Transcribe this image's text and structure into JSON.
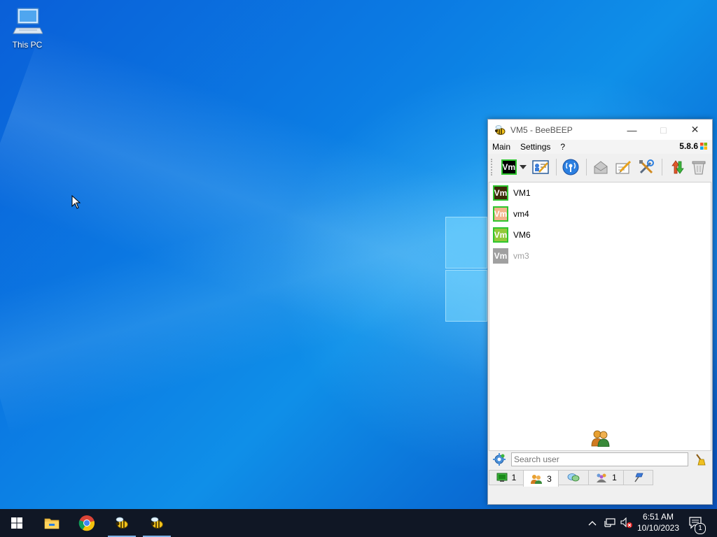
{
  "desktop": {
    "icons": [
      {
        "label": "This PC",
        "icon": "computer-icon"
      }
    ]
  },
  "window": {
    "title": "VM5 - BeeBEEP",
    "controls": {
      "minimize": "—",
      "maximize": "□",
      "close": "✕"
    },
    "menu": [
      "Main",
      "Settings",
      "?"
    ],
    "version": "5.8.6",
    "toolbar": {
      "status_badge": "Vm",
      "items": [
        "profile-icon",
        "network-icon",
        "message-icon",
        "write-icon",
        "tools-icon",
        "update-icon",
        "trash-icon"
      ]
    },
    "users": [
      {
        "initials": "Vm",
        "name": "VM1",
        "color": "#3d2a08",
        "status": "online"
      },
      {
        "initials": "Vm",
        "name": "vm4",
        "color": "#f2b48a",
        "status": "online"
      },
      {
        "initials": "Vm",
        "name": "VM6",
        "color": "#93c93a",
        "status": "online"
      },
      {
        "initials": "Vm",
        "name": "vm3",
        "color": "#a0a0a0",
        "status": "offline"
      }
    ],
    "search": {
      "placeholder": "Search user",
      "value": ""
    },
    "tabs": [
      {
        "icon": "computer-green-icon",
        "count": "1"
      },
      {
        "icon": "users-icon",
        "count": "3"
      },
      {
        "icon": "chat-icon",
        "count": ""
      },
      {
        "icon": "groups-icon",
        "count": "1"
      },
      {
        "icon": "pin-icon",
        "count": ""
      }
    ]
  },
  "taskbar": {
    "apps": [
      "start-icon",
      "file-explorer-icon",
      "chrome-icon",
      "beebeep-icon",
      "beebeep-icon"
    ],
    "time": "6:51 AM",
    "date": "10/10/2023",
    "notification_count": "1"
  },
  "colors": {
    "accent": "#2fc62f",
    "taskbar": "#101725"
  }
}
